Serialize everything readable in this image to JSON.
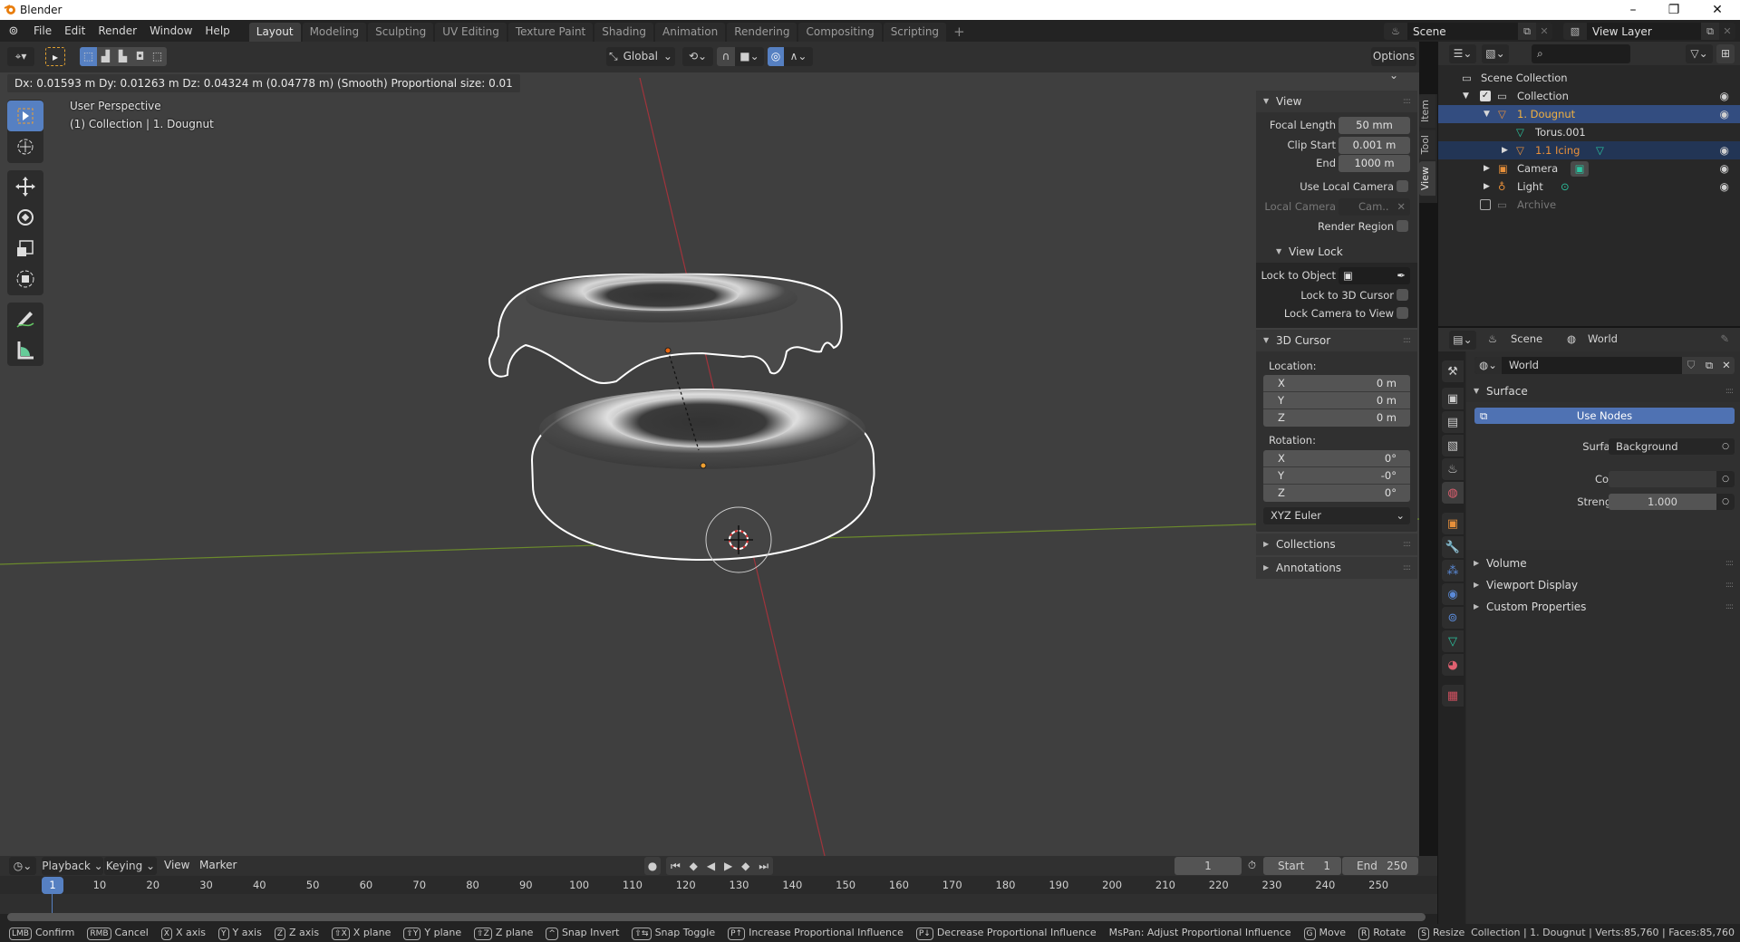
{
  "window": {
    "title": "Blender",
    "minimize": "–",
    "restore": "❐",
    "close": "✕"
  },
  "menu": {
    "items": [
      "File",
      "Edit",
      "Render",
      "Window",
      "Help"
    ]
  },
  "workspaces": {
    "tabs": [
      "Layout",
      "Modeling",
      "Sculpting",
      "UV Editing",
      "Texture Paint",
      "Shading",
      "Animation",
      "Rendering",
      "Compositing",
      "Scripting"
    ],
    "active": "Layout",
    "add": "+"
  },
  "scene_selector": {
    "value": "Scene"
  },
  "view_layer_selector": {
    "value": "View Layer"
  },
  "viewport_header": {
    "transform_orientation": "Global",
    "options": "Options"
  },
  "viewport": {
    "transform_info": "Dx: 0.01593 m   Dy: 0.01263 m  Dz: 0.04324 m (0.04778 m) (Smooth)   Proportional size: 0.01",
    "view_name": "User Perspective",
    "context": "(1) Collection | 1. Dougnut"
  },
  "toolbar": {
    "tools": [
      "select-box",
      "cursor",
      "move",
      "rotate",
      "scale",
      "transform",
      "annotate",
      "measure"
    ],
    "active": "select-box"
  },
  "sidebar": {
    "tabs": [
      "Item",
      "Tool",
      "View"
    ],
    "active_tab": "View",
    "view_panel": {
      "title": "View",
      "focal_length_label": "Focal Length",
      "focal_length": "50 mm",
      "clip_start_label": "Clip Start",
      "clip_start": "0.001 m",
      "end_label": "End",
      "end": "1000 m",
      "use_local_camera_label": "Use Local Camera",
      "local_camera_label": "Local Camera",
      "local_camera": "Cam..",
      "render_region_label": "Render Region"
    },
    "view_lock": {
      "title": "View Lock",
      "lock_to_object_label": "Lock to Object",
      "lock_to_3d_cursor_label": "Lock to 3D Cursor",
      "lock_camera_to_view_label": "Lock Camera to View"
    },
    "cursor_panel": {
      "title": "3D Cursor",
      "location_label": "Location:",
      "location": [
        {
          "axis": "X",
          "value": "0 m"
        },
        {
          "axis": "Y",
          "value": "0 m"
        },
        {
          "axis": "Z",
          "value": "0 m"
        }
      ],
      "rotation_label": "Rotation:",
      "rotation": [
        {
          "axis": "X",
          "value": "0°"
        },
        {
          "axis": "Y",
          "value": "-0°"
        },
        {
          "axis": "Z",
          "value": "0°"
        }
      ],
      "rotation_mode": "XYZ Euler"
    },
    "collections": "Collections",
    "annotations": "Annotations"
  },
  "outliner": {
    "items": [
      {
        "label": "Scene Collection"
      },
      {
        "label": "Collection"
      },
      {
        "label": "1. Dougnut"
      },
      {
        "label": "Torus.001"
      },
      {
        "label": "1.1 Icing"
      },
      {
        "label": "Camera"
      },
      {
        "label": "Light"
      },
      {
        "label": "Archive"
      }
    ]
  },
  "properties": {
    "breadcrumb": [
      "Scene",
      "World"
    ],
    "world_name": "World",
    "surface_panel": "Surface",
    "use_nodes": "Use Nodes",
    "surface_label": "Surface",
    "surface_value": "Background",
    "color_label": "Color",
    "strength_label": "Strength",
    "strength_value": "1.000",
    "collapsed_panels": [
      "Volume",
      "Viewport Display",
      "Custom Properties"
    ]
  },
  "timeline": {
    "menus": [
      "Playback",
      "Keying",
      "View",
      "Marker"
    ],
    "current_frame": "1",
    "start_label": "Start",
    "start": "1",
    "end_label": "End",
    "end": "250",
    "ruler": [
      "10",
      "20",
      "30",
      "40",
      "50",
      "60",
      "70",
      "80",
      "90",
      "100",
      "110",
      "120",
      "130",
      "140",
      "150",
      "160",
      "170",
      "180",
      "190",
      "200",
      "210",
      "220",
      "230",
      "240",
      "250"
    ]
  },
  "statusbar": {
    "hints": [
      {
        "key": "LMB",
        "label": "Confirm"
      },
      {
        "key": "RMB",
        "label": "Cancel"
      },
      {
        "key": "X",
        "label": "X axis"
      },
      {
        "key": "Y",
        "label": "Y axis"
      },
      {
        "key": "Z",
        "label": "Z axis"
      },
      {
        "key": "⇧X",
        "label": "X plane"
      },
      {
        "key": "⇧Y",
        "label": "Y plane"
      },
      {
        "key": "⇧Z",
        "label": "Z plane"
      },
      {
        "key": "^",
        "label": "Snap Invert"
      },
      {
        "key": "⇧⇆",
        "label": "Snap Toggle"
      },
      {
        "key": "P↑",
        "label": "Increase Proportional Influence"
      },
      {
        "key": "P↓",
        "label": "Decrease Proportional Influence"
      },
      {
        "key": "",
        "label": "MsPan: Adjust Proportional Influence"
      },
      {
        "key": "G",
        "label": "Move"
      },
      {
        "key": "R",
        "label": "Rotate"
      },
      {
        "key": "S",
        "label": "Resize"
      }
    ],
    "stats": "Collection | 1. Dougnut | Verts:85,760 | Faces:85,760"
  }
}
